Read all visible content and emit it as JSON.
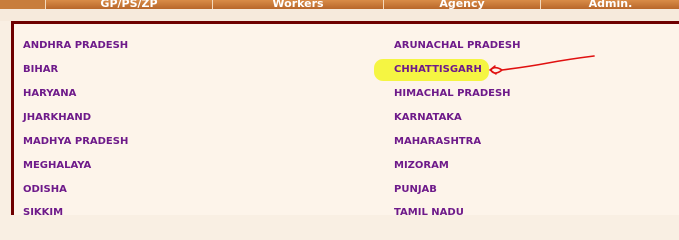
{
  "nav": {
    "tabs": [
      "GP/PS/ZP",
      "Workers",
      "Agency",
      "Admin."
    ]
  },
  "states": {
    "left": [
      "ANDHRA PRADESH",
      "BIHAR",
      "HARYANA",
      "JHARKHAND",
      "MADHYA PRADESH",
      "MEGHALAYA",
      "ODISHA",
      "SIKKIM"
    ],
    "right": [
      "ARUNACHAL PRADESH",
      "CHHATTISGARH",
      "HIMACHAL PRADESH",
      "KARNATAKA",
      "MAHARASHTRA",
      "MIZORAM",
      "PUNJAB",
      "TAMIL NADU"
    ]
  },
  "colors": {
    "nav_tab": "#c87d3c",
    "panel_border": "#6e0000",
    "state_link": "#6e1a8a",
    "highlight": "#f5f542",
    "annotation_arrow": "#e01010"
  }
}
